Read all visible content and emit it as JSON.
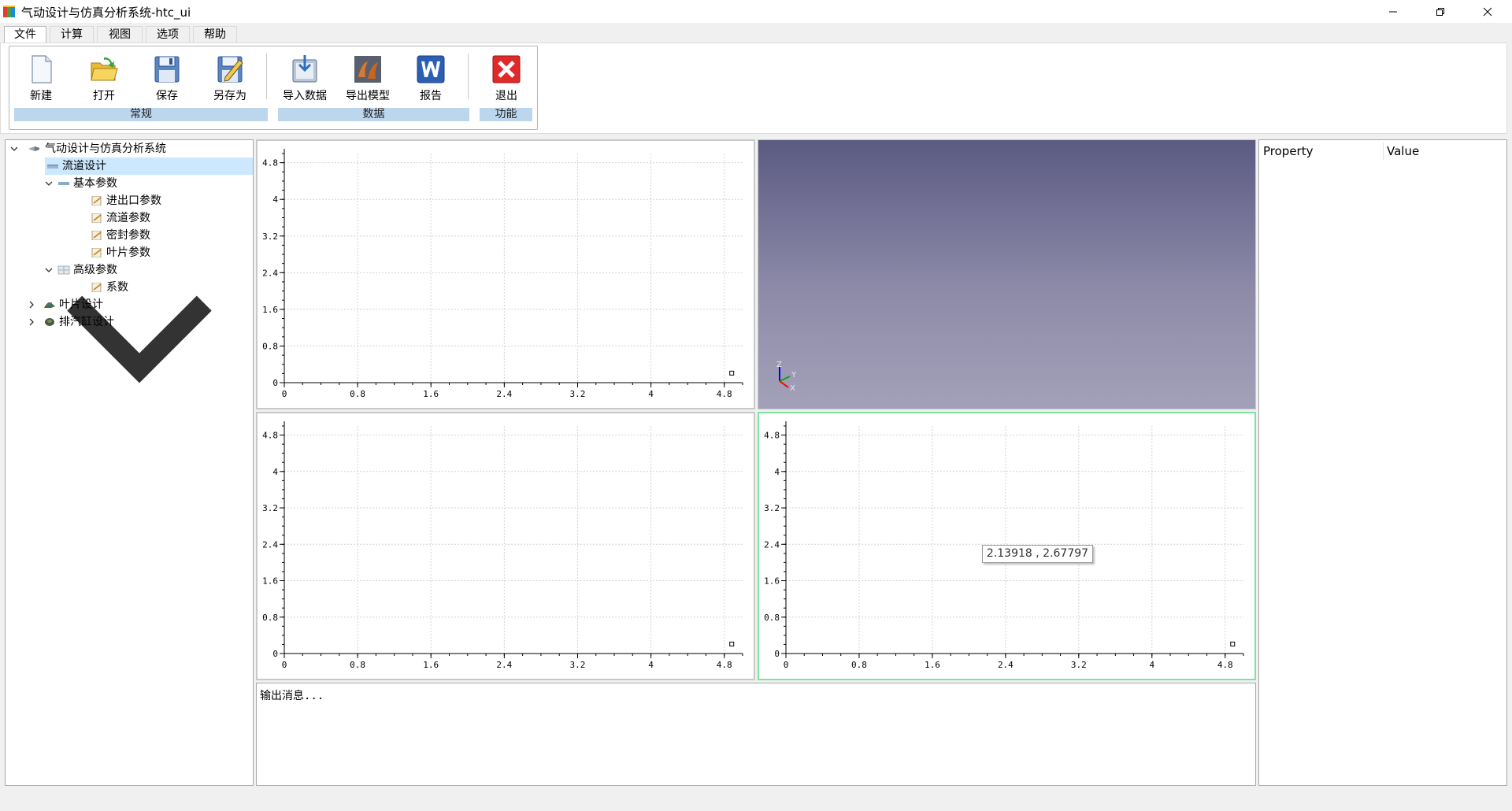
{
  "window": {
    "title": "气动设计与仿真分析系统-htc_ui"
  },
  "menu": {
    "tabs": [
      "文件",
      "计算",
      "视图",
      "选项",
      "帮助"
    ],
    "active": "文件"
  },
  "ribbon": {
    "buttons": [
      {
        "label": "新建",
        "icon": "new-file-icon"
      },
      {
        "label": "打开",
        "icon": "open-folder-icon"
      },
      {
        "label": "保存",
        "icon": "save-disk-icon"
      },
      {
        "label": "另存为",
        "icon": "save-as-icon"
      },
      {
        "label": "导入数据",
        "icon": "import-data-icon"
      },
      {
        "label": "导出模型",
        "icon": "export-model-icon"
      },
      {
        "label": "报告",
        "icon": "word-report-icon"
      },
      {
        "label": "退出",
        "icon": "exit-icon"
      }
    ],
    "groups": [
      "常规",
      "数据",
      "功能"
    ]
  },
  "tree": {
    "root": "气动设计与仿真分析系统",
    "nodes": [
      "流道设计",
      "基本参数",
      "进出口参数",
      "流道参数",
      "密封参数",
      "叶片参数",
      "高级参数",
      "系数",
      "叶片设计",
      "排汽缸设计"
    ],
    "selected": "流道设计"
  },
  "plot": {
    "ticks": [
      "0",
      "0.8",
      "1.6",
      "2.4",
      "3.2",
      "4",
      "4.8"
    ],
    "tick_values": [
      0,
      0.8,
      1.6,
      2.4,
      3.2,
      4,
      4.8
    ],
    "range": [
      0,
      5.0
    ],
    "marker_point": [
      4.8,
      0.2
    ]
  },
  "view3d": {
    "axes": [
      "Z",
      "Y",
      "X"
    ],
    "axis_colors": [
      "#0000ff",
      "#00aa00",
      "#ff0000"
    ]
  },
  "tooltip": {
    "text": "2.13918 , 2.67797"
  },
  "output": {
    "text": "输出消息..."
  },
  "properties": {
    "col_property": "Property",
    "col_value": "Value"
  },
  "colors": {
    "ribbon_group": "#bcd6ee",
    "selection": "#cce8ff",
    "active_panel_border": "#7fe3a0"
  }
}
